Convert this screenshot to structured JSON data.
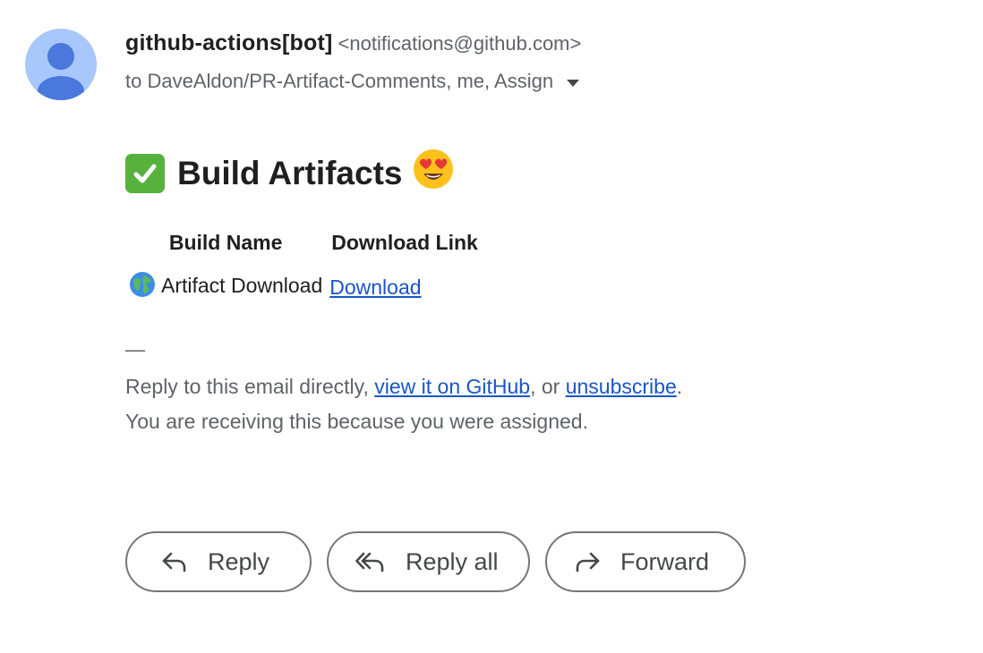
{
  "sender": {
    "name": "github-actions[bot]",
    "email": "<notifications@github.com>",
    "recipients": "to DaveAldon/PR-Artifact-Comments, me, Assign"
  },
  "body": {
    "heading": "Build Artifacts",
    "table": {
      "headers": [
        "Build Name",
        "Download Link"
      ],
      "rows": [
        {
          "name": "Artifact Download",
          "link_text": "Download"
        }
      ]
    },
    "signature_dash": "—",
    "footer": {
      "prefix": "Reply to this email directly, ",
      "view_link": "view it on GitHub",
      "middle": ", or ",
      "unsubscribe_link": "unsubscribe",
      "suffix": ".",
      "reason": "You are receiving this because you were assigned."
    }
  },
  "actions": {
    "reply": "Reply",
    "reply_all": "Reply all",
    "forward": "Forward"
  },
  "icons": {
    "avatar": "person-icon",
    "caret": "caret-down-icon",
    "check": "white-check-mark-icon",
    "face": "heart-eyes-face-icon",
    "globe": "globe-icon",
    "reply": "reply-arrow-icon",
    "reply_all": "reply-all-arrow-icon",
    "forward": "forward-arrow-icon"
  },
  "colors": {
    "link": "#1a55c7",
    "avatar_bg": "#a8c7fa",
    "avatar_fg": "#4a78dc",
    "check_bg": "#57b13d"
  }
}
